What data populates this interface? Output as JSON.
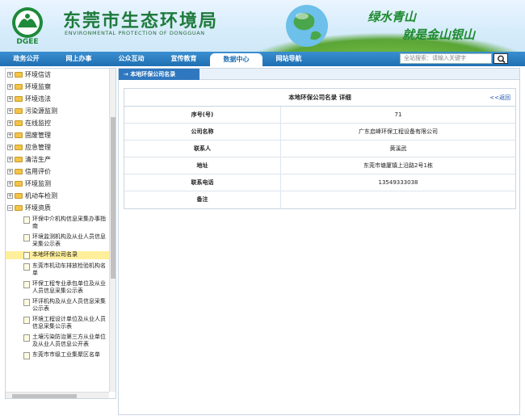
{
  "header": {
    "title": "东莞市生态环境局",
    "subtitle": "ENVIRONMENTAL PROTECTION OF DONGGUAN",
    "logo_text": "DGEE",
    "slogan_line1": "绿水青山",
    "slogan_line2": "就是金山银山"
  },
  "nav": {
    "items": [
      "政务公开",
      "网上办事",
      "公众互动",
      "宣传教育",
      "数据中心",
      "网站导航"
    ],
    "active_index": 4,
    "search_placeholder": "全站搜索：请输入关键字"
  },
  "tree": {
    "categories": [
      "环境信访",
      "环境监察",
      "环境违法",
      "污染源监测",
      "在线监控",
      "固废管理",
      "应急管理",
      "清洁生产",
      "信用评价",
      "环境监测",
      "机动车检测"
    ],
    "expanded": "环境资质",
    "children": [
      "环保中介机构信息采集办事指南",
      "环境监测机构及从业人员信息采集公示表",
      "本地环保公司名录",
      "东莞市机动车排放检验机构名单",
      "环保工程专业承包单位及从业人员信息采集公示表",
      "环评机构及从业人员信息采集公示表",
      "环境工程设计单位及从业人员信息采集公示表",
      "土壤污染防治第三方从业单位及从业人员信息公开表",
      "东莞市市级工业集聚区名单"
    ],
    "selected_index": 2
  },
  "content": {
    "tab_label": "本地环保公司名录",
    "panel_title": "本地环保公司名录  详细",
    "back_label": "<<返回",
    "rows": [
      {
        "key": "序号(号)",
        "value": "71"
      },
      {
        "key": "公司名称",
        "value": "广东启峰环保工程设备有限公司"
      },
      {
        "key": "联系人",
        "value": "黄溪武"
      },
      {
        "key": "地址",
        "value": "东莞市塘厦镇上沿路2号1栋"
      },
      {
        "key": "联系电话",
        "value": "13549333038"
      },
      {
        "key": "备注",
        "value": ""
      }
    ]
  },
  "colors": {
    "nav_bg": "#1f6fb2",
    "title_green": "#1e7a3a",
    "tab_blue": "#2f78bf",
    "selected_bg": "#ffef9a"
  }
}
